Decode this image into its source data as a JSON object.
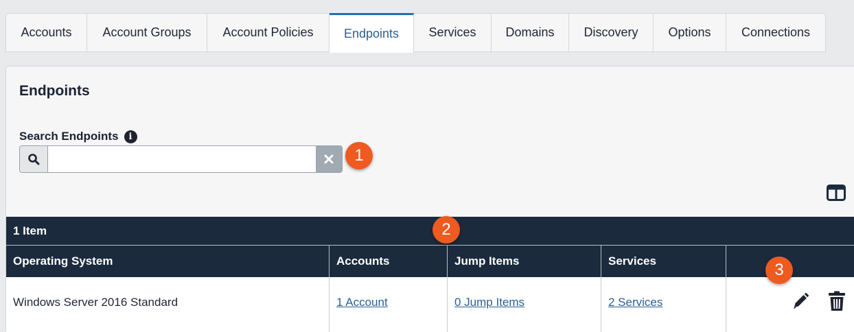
{
  "tabs": [
    {
      "label": "Accounts",
      "active": false
    },
    {
      "label": "Account Groups",
      "active": false
    },
    {
      "label": "Account Policies",
      "active": false
    },
    {
      "label": "Endpoints",
      "active": true
    },
    {
      "label": "Services",
      "active": false
    },
    {
      "label": "Domains",
      "active": false
    },
    {
      "label": "Discovery",
      "active": false
    },
    {
      "label": "Options",
      "active": false
    },
    {
      "label": "Connections",
      "active": false
    }
  ],
  "panel": {
    "title": "Endpoints",
    "search": {
      "label": "Search Endpoints",
      "value": "",
      "placeholder": ""
    }
  },
  "callouts": [
    "1",
    "2",
    "3"
  ],
  "table": {
    "count_label": "1 Item",
    "columns": [
      "Operating System",
      "Accounts",
      "Jump Items",
      "Services",
      ""
    ],
    "rows": [
      {
        "os": "Windows Server 2016 Standard",
        "accounts": "1 Account",
        "jump_items": "0 Jump Items",
        "services": "2 Services"
      }
    ]
  },
  "colors": {
    "accent": "#2a6cb0",
    "table_header": "#1b2a3d",
    "callout": "#ee5a1f",
    "link": "#2a5f94"
  },
  "icons": [
    "search-icon",
    "clear-icon",
    "info-icon",
    "columns-icon",
    "edit-icon",
    "trash-icon"
  ]
}
